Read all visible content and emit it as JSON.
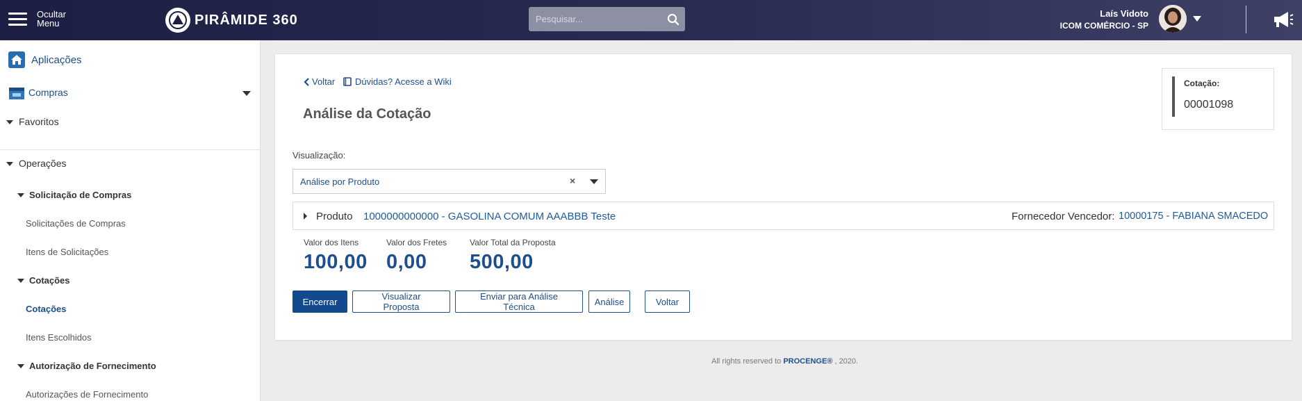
{
  "header": {
    "menu_label": "Ocultar Menu",
    "logo_text": "PIRÂMIDE 360",
    "search_placeholder": "Pesquisar...",
    "user_name": "Laís Vidoto",
    "user_company": "ICOM COMÉRCIO - SP"
  },
  "sidebar": {
    "app_label": "Aplicações",
    "module_label": "Compras",
    "favoritos": "Favoritos",
    "operacoes": "Operações",
    "items": [
      {
        "label": "Solicitação de Compras"
      },
      {
        "label": "Solicitações de Compras"
      },
      {
        "label": "Itens de Solicitações"
      },
      {
        "label": "Cotações"
      },
      {
        "label": "Cotações"
      },
      {
        "label": "Itens Escolhidos"
      },
      {
        "label": "Autorização de Fornecimento"
      },
      {
        "label": "Autorizações de Fornecimento"
      }
    ]
  },
  "main": {
    "back_label": "Voltar",
    "wiki_label": "Dúvidas? Acesse a Wiki",
    "title": "Análise da Cotação",
    "cotacao_label": "Cotação:",
    "cotacao_value": "00001098",
    "visualizacao_label": "Visualização:",
    "visualizacao_value": "Análise por Produto",
    "produto_label": "Produto",
    "produto_value": "1000000000000 - GASOLINA COMUM AAABBB Teste",
    "fornecedor_label": "Fornecedor Vencedor:",
    "fornecedor_value": "10000175 - FABIANA SMACEDO",
    "stats": [
      {
        "label": "Valor dos Itens",
        "value": "100,00"
      },
      {
        "label": "Valor dos Fretes",
        "value": "0,00"
      },
      {
        "label": "Valor Total da Proposta",
        "value": "500,00"
      }
    ],
    "buttons": {
      "encerrar": "Encerrar",
      "visualizar": "Visualizar Proposta",
      "enviar": "Enviar para Análise Técnica",
      "analise": "Análise",
      "voltar": "Voltar"
    }
  },
  "footer": {
    "prefix": "All rights reserved to",
    "brand": "PROCENGE®",
    "suffix": ", 2020."
  },
  "colors": {
    "primary": "#134a8e",
    "link": "#1e4e8c",
    "topbar": "#1c1e44"
  }
}
